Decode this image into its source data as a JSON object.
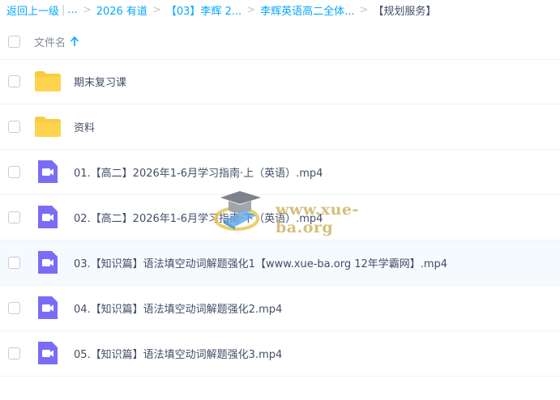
{
  "breadcrumb": {
    "back": "返回上一级",
    "ellipsis": "...",
    "crumbs": [
      "2026 有道",
      "【03】李辉 2...",
      "李辉英语高二全体...",
      "【规划服务】"
    ]
  },
  "header": {
    "column_name": "文件名"
  },
  "files": [
    {
      "name": "期末复习课",
      "type": "folder"
    },
    {
      "name": "资料",
      "type": "folder"
    },
    {
      "name": "01.【高二】2026年1-6月学习指南·上（英语）.mp4",
      "type": "video"
    },
    {
      "name": "02.【高二】2026年1-6月学习指南·下（英语）.mp4",
      "type": "video"
    },
    {
      "name": "03.【知识篇】语法填空动词解题强化1【www.xue-ba.org 12年学霸网】.mp4",
      "type": "video"
    },
    {
      "name": "04.【知识篇】语法填空动词解题强化2.mp4",
      "type": "video"
    },
    {
      "name": "05.【知识篇】语法填空动词解题强化3.mp4",
      "type": "video"
    }
  ],
  "watermark": {
    "text": "www.xue-ba.org"
  },
  "colors": {
    "accent": "#06a7ff",
    "folder": "#f9cb3e",
    "video": "#7b6cf6"
  }
}
